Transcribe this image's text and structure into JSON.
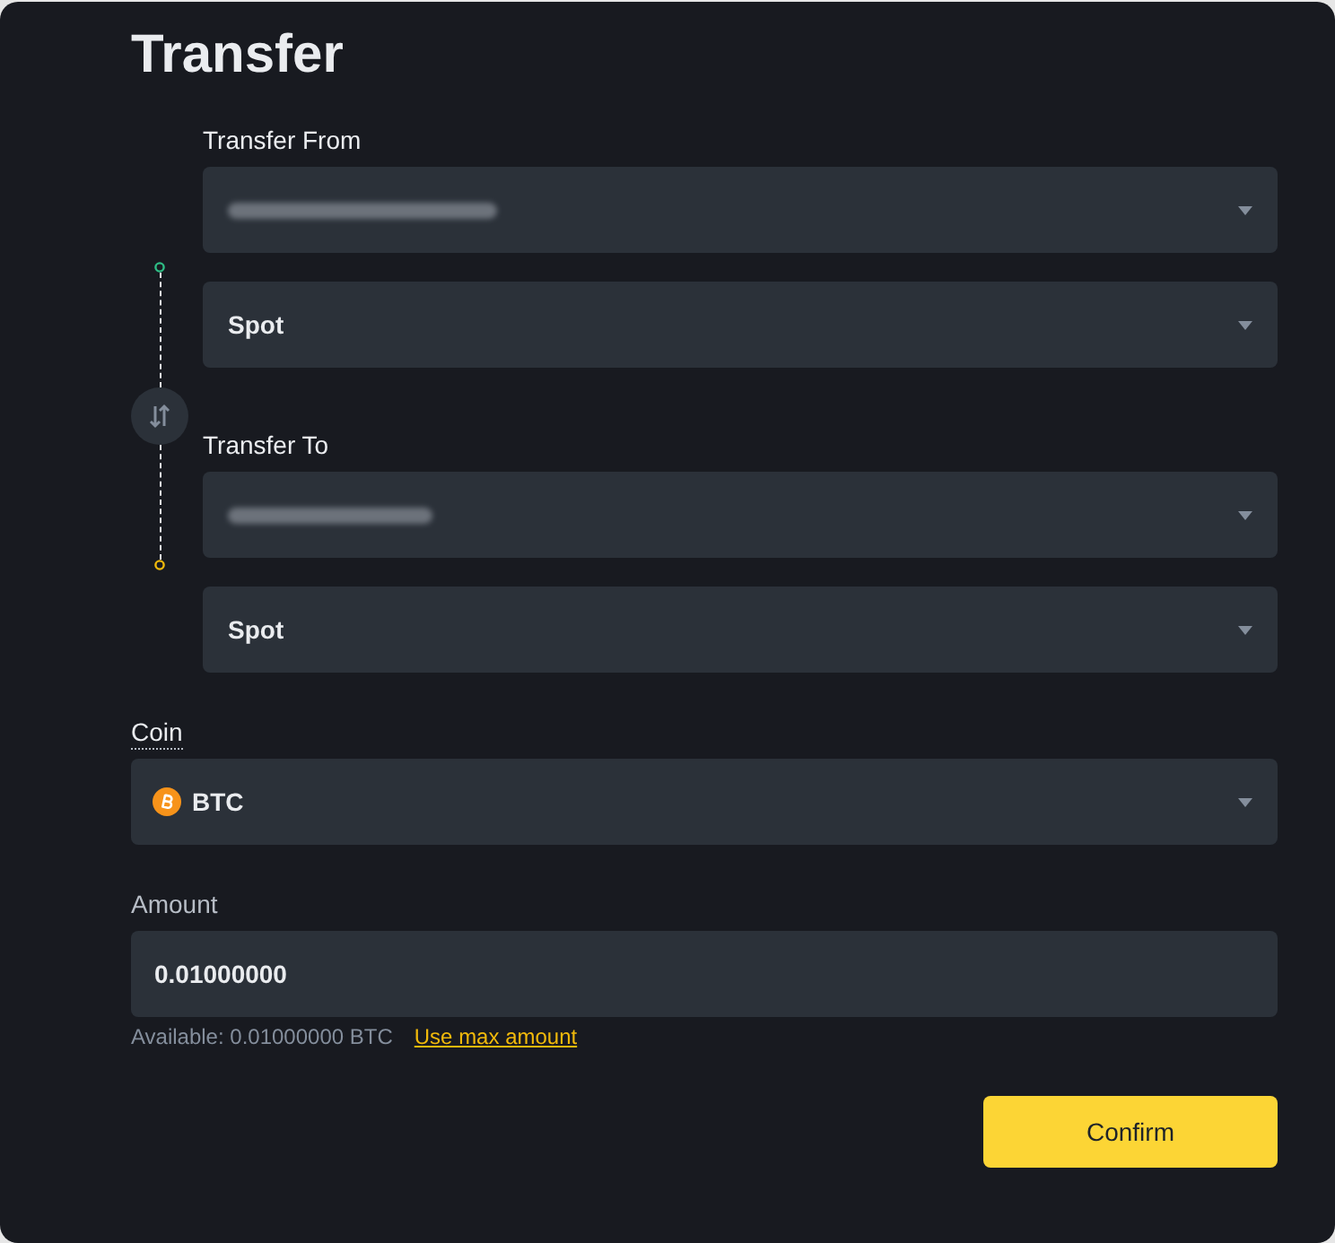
{
  "title": "Transfer",
  "transfer_from": {
    "label": "Transfer From",
    "fields": [
      {
        "kind": "account"
      },
      {
        "kind": "wallet",
        "value": "Spot"
      }
    ]
  },
  "transfer_to": {
    "label": "Transfer To",
    "fields": [
      {
        "kind": "account"
      },
      {
        "kind": "wallet",
        "value": "Spot"
      }
    ]
  },
  "coin": {
    "label": "Coin",
    "value": "BTC"
  },
  "amount": {
    "label": "Amount",
    "value": "0.01000000",
    "available": "Available: 0.01000000 BTC",
    "max_link": "Use max amount"
  },
  "confirm_button": "Confirm"
}
